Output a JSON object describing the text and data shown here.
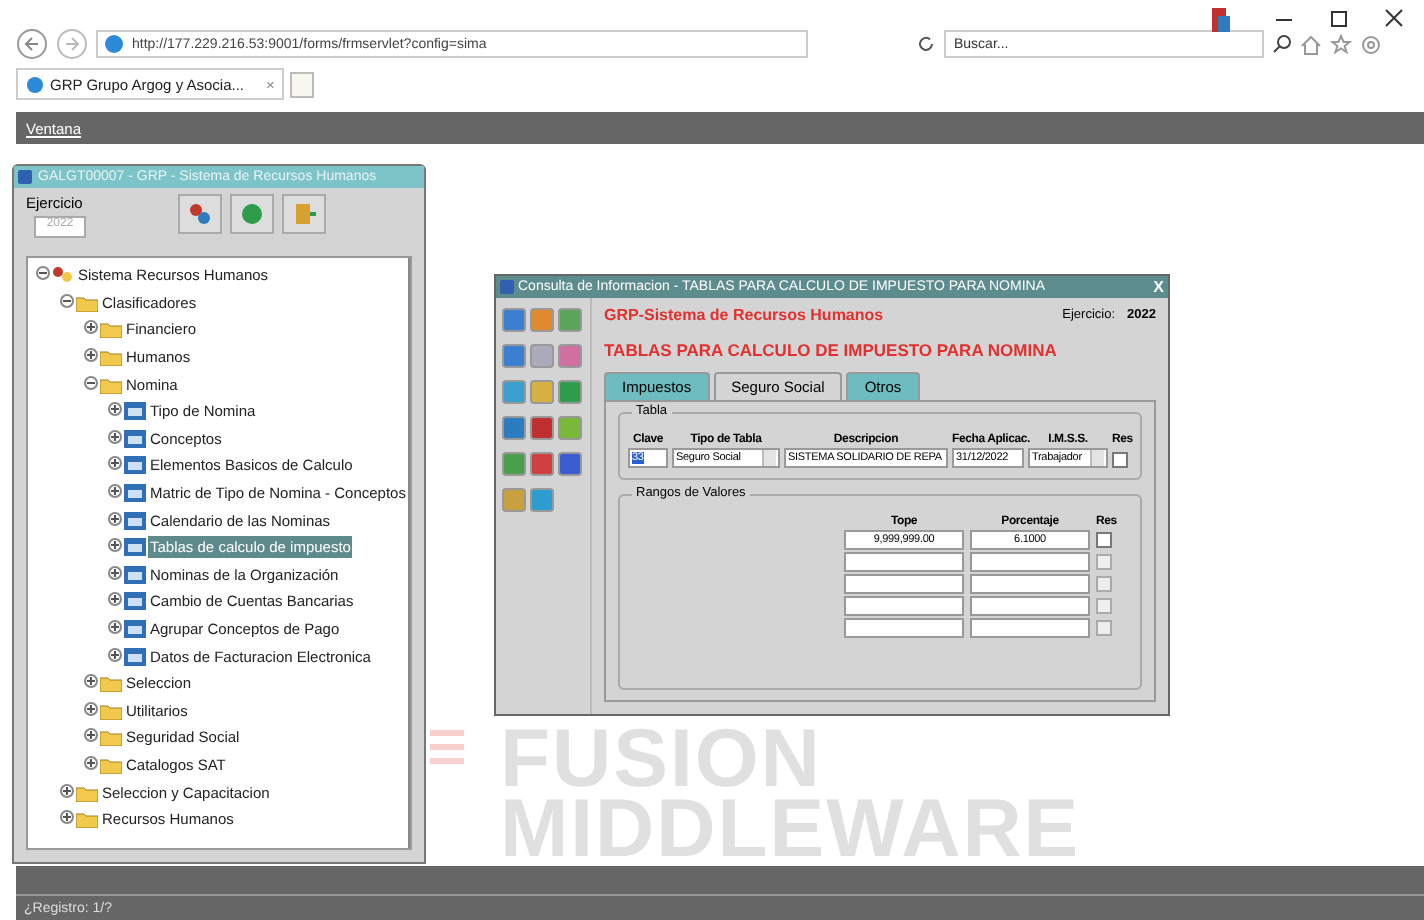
{
  "browser": {
    "url": "http://177.229.216.53:9001/forms/frmservlet?config=sima",
    "search": {
      "placeholder": "Buscar..."
    },
    "tab": {
      "title": "GRP Grupo Argog y Asocia...",
      "close": "×"
    }
  },
  "menu_bar": {
    "items": [
      "Ventana"
    ]
  },
  "nav_window": {
    "title": "GALGT00007 - GRP - Sistema de Recursos Humanos",
    "ejercicio_label": "Ejercicio",
    "ejercicio_value": "2022",
    "tree": [
      {
        "label": "Sistema Recursos Humanos",
        "kind": "root",
        "expanded": true,
        "selected": false,
        "children": [
          {
            "label": "Clasificadores",
            "kind": "folder",
            "expanded": true,
            "selected": false,
            "children": [
              {
                "label": "Financiero",
                "kind": "folder",
                "expanded": false,
                "selected": false
              },
              {
                "label": "Humanos",
                "kind": "folder",
                "expanded": false,
                "selected": false
              },
              {
                "label": "Nomina",
                "kind": "folder",
                "expanded": true,
                "selected": false,
                "children": [
                  {
                    "label": "Tipo de Nomina",
                    "kind": "form",
                    "expanded": false,
                    "selected": false
                  },
                  {
                    "label": "Conceptos",
                    "kind": "form",
                    "expanded": false,
                    "selected": false
                  },
                  {
                    "label": "Elementos Basicos de Calculo",
                    "kind": "form",
                    "expanded": false,
                    "selected": false
                  },
                  {
                    "label": "Matric de Tipo de Nomina - Conceptos",
                    "kind": "form",
                    "expanded": false,
                    "selected": false
                  },
                  {
                    "label": "Calendario de las Nominas",
                    "kind": "form",
                    "expanded": false,
                    "selected": false
                  },
                  {
                    "label": "Tablas de calculo de impuesto",
                    "kind": "form",
                    "expanded": false,
                    "selected": true
                  },
                  {
                    "label": "Nominas de la Organización",
                    "kind": "form",
                    "expanded": false,
                    "selected": false
                  },
                  {
                    "label": "Cambio de Cuentas Bancarias",
                    "kind": "form",
                    "expanded": false,
                    "selected": false
                  },
                  {
                    "label": "Agrupar Conceptos de Pago",
                    "kind": "form",
                    "expanded": false,
                    "selected": false
                  },
                  {
                    "label": "Datos de Facturacion Electronica",
                    "kind": "form",
                    "expanded": false,
                    "selected": false
                  }
                ]
              },
              {
                "label": "Seleccion",
                "kind": "folder",
                "expanded": false,
                "selected": false
              },
              {
                "label": "Utilitarios",
                "kind": "folder",
                "expanded": false,
                "selected": false
              },
              {
                "label": "Seguridad Social",
                "kind": "folder",
                "expanded": false,
                "selected": false
              },
              {
                "label": "Catalogos SAT",
                "kind": "folder",
                "expanded": false,
                "selected": false
              }
            ]
          },
          {
            "label": "Seleccion y Capacitacion",
            "kind": "folder",
            "expanded": false,
            "selected": false
          },
          {
            "label": "Recursos Humanos",
            "kind": "folder",
            "expanded": false,
            "selected": false
          }
        ]
      }
    ]
  },
  "dialog": {
    "title": "Consulta de Informacion - TABLAS PARA CALCULO DE IMPUESTO PARA NOMINA",
    "close": "X",
    "system": "GRP-Sistema de Recursos Humanos",
    "ejercicio_label": "Ejercicio:",
    "ejercicio_value": "2022",
    "heading": "TABLAS PARA CALCULO DE IMPUESTO PARA NOMINA",
    "tabs": [
      {
        "label": "Impuestos",
        "selected": false
      },
      {
        "label": "Seguro Social",
        "selected": true
      },
      {
        "label": "Otros",
        "selected": false
      }
    ],
    "tabla": {
      "title": "Tabla",
      "columns": [
        "Clave",
        "Tipo de Tabla",
        "Descripcion",
        "Fecha Aplicac.",
        "I.M.S.S.",
        "Res"
      ],
      "clave": "33",
      "tipo": "Seguro Social",
      "descripcion": "SISTEMA SOLIDARIO DE REPA",
      "fecha": "31/12/2022",
      "imss": "Trabajador",
      "res_checked": false
    },
    "rangos": {
      "title": "Rangos de Valores",
      "columns": [
        "Tope",
        "Porcentaje",
        "Res"
      ],
      "rows": [
        {
          "tope": "9,999,999.00",
          "porcentaje": "6.1000",
          "res_checked": false,
          "disabled": false
        },
        {
          "tope": "",
          "porcentaje": "",
          "res_checked": false,
          "disabled": true
        },
        {
          "tope": "",
          "porcentaje": "",
          "res_checked": false,
          "disabled": true
        },
        {
          "tope": "",
          "porcentaje": "",
          "res_checked": false,
          "disabled": true
        },
        {
          "tope": "",
          "porcentaje": "",
          "res_checked": false,
          "disabled": true
        }
      ]
    }
  },
  "background": {
    "lines": [
      "FUSION",
      "MIDDLEWARE"
    ]
  },
  "status_bar": {
    "text": "¿Registro: 1/?"
  }
}
